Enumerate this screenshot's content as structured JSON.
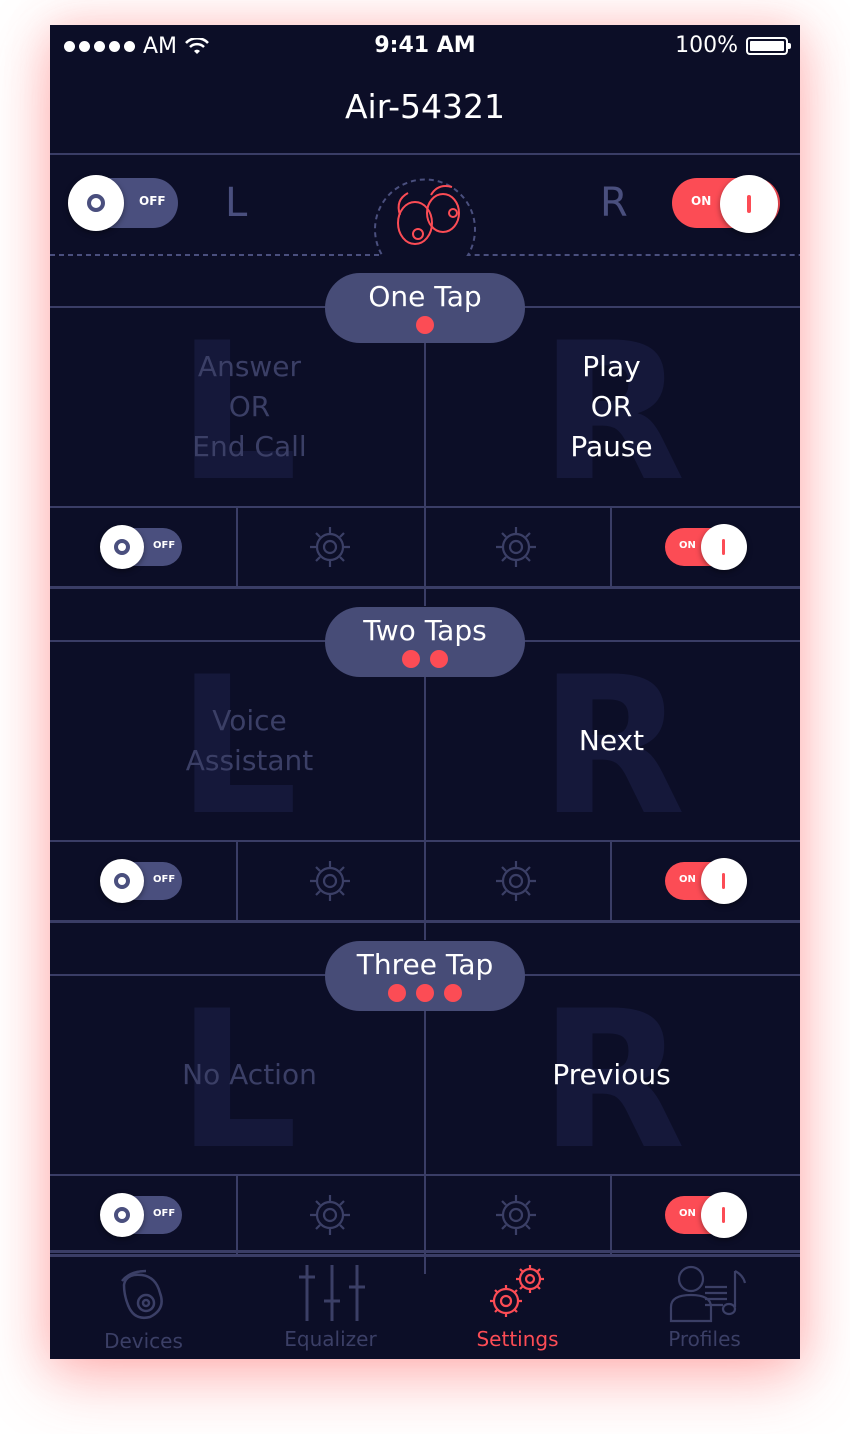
{
  "status_bar": {
    "carrier": "AM",
    "time": "9:41 AM",
    "battery": "100%"
  },
  "device_title": "Air-54321",
  "top": {
    "left_toggle_label": "OFF",
    "right_toggle_label": "ON",
    "left_letter": "L",
    "right_letter": "R"
  },
  "sections": [
    {
      "title": "One Tap",
      "dots": 1,
      "left_action": "Answer\nOR\nEnd Call",
      "right_action": "Play\nOR\nPause",
      "left_toggle": "OFF",
      "right_toggle": "ON"
    },
    {
      "title": "Two Taps",
      "dots": 2,
      "left_action": "Voice\nAssistant",
      "right_action": "Next",
      "left_toggle": "OFF",
      "right_toggle": "ON"
    },
    {
      "title": "Three Tap",
      "dots": 3,
      "left_action": "No Action",
      "right_action": "Previous",
      "left_toggle": "OFF",
      "right_toggle": "ON"
    }
  ],
  "bg_letters": {
    "left": "L",
    "right": "R"
  },
  "tabs": [
    {
      "label": "Devices",
      "icon": "earbud-icon",
      "color": "#3b3f66"
    },
    {
      "label": "Equalizer",
      "icon": "equalizer-icon",
      "color": "#3b3f66"
    },
    {
      "label": "Settings",
      "icon": "gears-icon",
      "color": "#fc4c55"
    },
    {
      "label": "Profiles",
      "icon": "profile-music-icon",
      "color": "#3b3f66"
    }
  ],
  "colors": {
    "background": "#0c0e27",
    "accent": "#fc4c55",
    "pill": "#474c77",
    "line": "#3a3d66",
    "dim_text": "#3b3f66"
  }
}
